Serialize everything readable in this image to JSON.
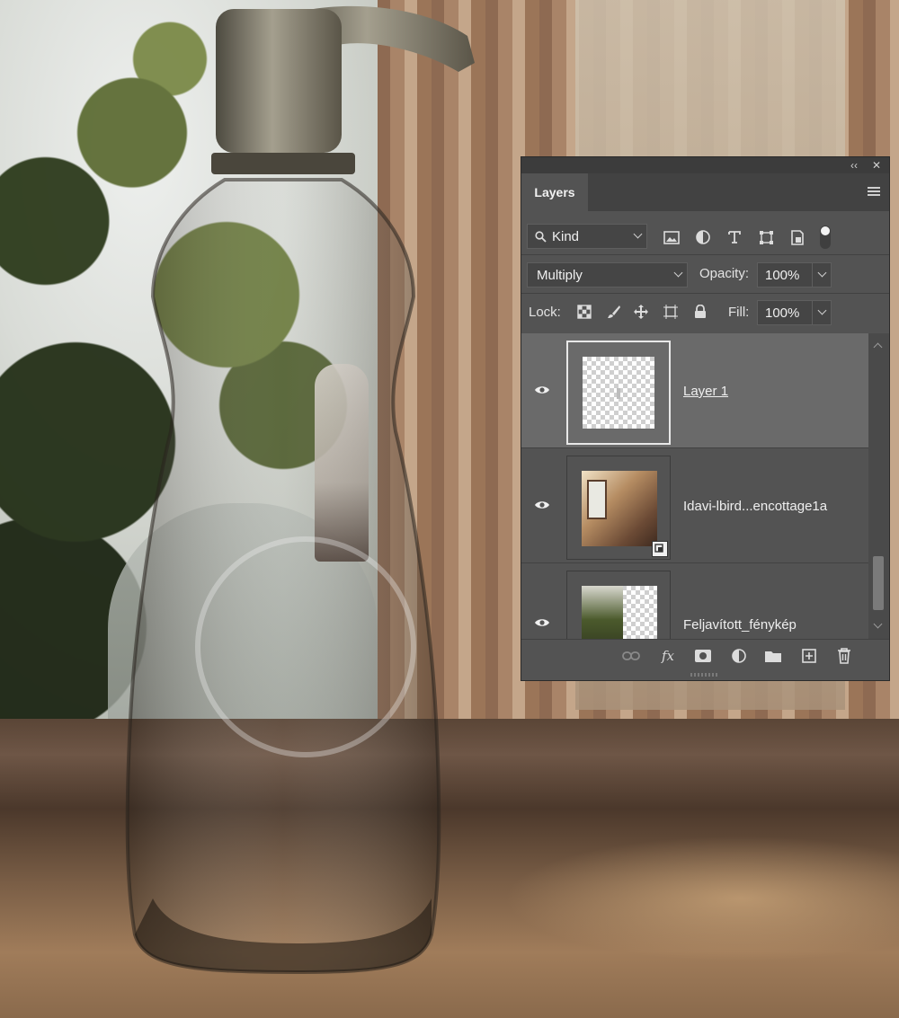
{
  "panel": {
    "tab_label": "Layers",
    "collapse_icon": "double-chevron-left-icon",
    "close_icon": "close-icon",
    "filter": {
      "kind_label": "Kind",
      "icons": [
        "image-filter-icon",
        "adjustment-filter-icon",
        "type-filter-icon",
        "shape-filter-icon",
        "smart-object-filter-icon",
        "filter-toggle-icon"
      ]
    },
    "blend_mode": "Multiply",
    "opacity_label": "Opacity:",
    "opacity_value": "100%",
    "lock_label": "Lock:",
    "lock_icons": [
      "lock-transparent-pixels-icon",
      "lock-image-pixels-icon",
      "lock-position-icon",
      "lock-artboard-icon",
      "lock-all-icon"
    ],
    "fill_label": "Fill:",
    "fill_value": "100%",
    "layers": [
      {
        "name": "Layer 1",
        "visible": true,
        "selected": true
      },
      {
        "name": "Idavi-lbird...encottage1a",
        "visible": true,
        "selected": false,
        "smart_object": true
      },
      {
        "name": "Feljavított_fénykép",
        "visible": true,
        "selected": false
      }
    ],
    "footer_icons": [
      "link-layers-icon",
      "fx-icon",
      "add-mask-icon",
      "new-adjustment-icon",
      "new-group-icon",
      "new-layer-icon",
      "delete-layer-icon"
    ]
  },
  "colors": {
    "panel_bg": "#535353",
    "selected_row": "#6a6a6a",
    "text": "#e6e6e6"
  }
}
